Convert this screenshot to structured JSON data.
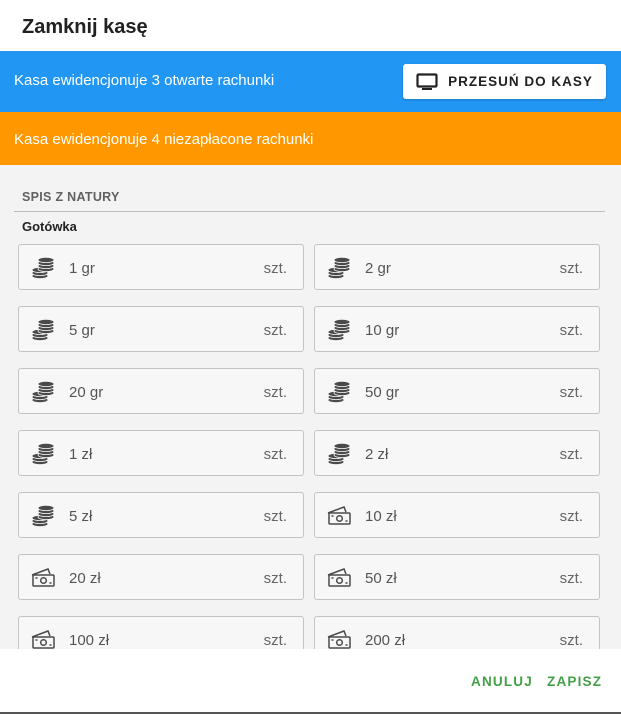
{
  "dialog": {
    "title": "Zamknij kasę",
    "open_bills_message": "Kasa ewidencjonuje 3 otwarte rachunki",
    "move_button_label": "PRZESUŃ DO KASY",
    "unpaid_bills_message": "Kasa ewidencjonuje 4 niezapłacone rachunki",
    "section_header": "SPIS Z NATURY",
    "cash_label": "Gotówka",
    "unit": "szt.",
    "denominations": [
      {
        "label": "1 gr",
        "icon": "coins-icon"
      },
      {
        "label": "2 gr",
        "icon": "coins-icon"
      },
      {
        "label": "5 gr",
        "icon": "coins-icon"
      },
      {
        "label": "10 gr",
        "icon": "coins-icon"
      },
      {
        "label": "20 gr",
        "icon": "coins-icon"
      },
      {
        "label": "50 gr",
        "icon": "coins-icon"
      },
      {
        "label": "1 zł",
        "icon": "coins-icon"
      },
      {
        "label": "2 zł",
        "icon": "coins-icon"
      },
      {
        "label": "5 zł",
        "icon": "coins-icon"
      },
      {
        "label": "10 zł",
        "icon": "banknote-icon"
      },
      {
        "label": "20 zł",
        "icon": "banknote-icon"
      },
      {
        "label": "50 zł",
        "icon": "banknote-icon"
      },
      {
        "label": "100 zł",
        "icon": "banknote-icon"
      },
      {
        "label": "200 zł",
        "icon": "banknote-icon"
      }
    ],
    "cancel_label": "ANULUJ",
    "save_label": "ZAPISZ"
  },
  "colors": {
    "info_banner": "#2196f3",
    "warning_banner": "#ff9800",
    "action_text": "#43a047"
  }
}
